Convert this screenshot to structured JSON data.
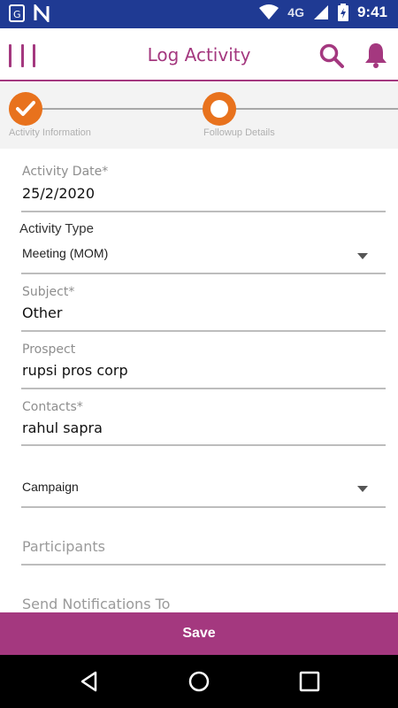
{
  "status_bar": {
    "network": "4G",
    "time": "9:41",
    "icons": [
      "sim-icon",
      "notification-n-icon",
      "wifi-icon",
      "signal-icon",
      "battery-charging-icon"
    ]
  },
  "app_bar": {
    "title": "Log Activity",
    "accent_color": "#a4387f"
  },
  "stepper": {
    "steps": [
      {
        "label": "Activity Information",
        "state": "completed"
      },
      {
        "label": "Followup Details",
        "state": "current"
      }
    ],
    "step_color": "#e8721d"
  },
  "form": {
    "activity_date": {
      "label": "Activity Date*",
      "value": "25/2/2020"
    },
    "activity_type": {
      "label": "Activity Type",
      "value": "Meeting (MOM)"
    },
    "subject": {
      "label": "Subject*",
      "value": "Other"
    },
    "prospect": {
      "label": "Prospect",
      "value": "rupsi pros corp"
    },
    "contacts": {
      "label": "Contacts*",
      "value": "rahul sapra"
    },
    "campaign": {
      "value": "Campaign"
    },
    "participants": {
      "placeholder": "Participants"
    },
    "send_notifications": {
      "placeholder": "Send Notifications To"
    }
  },
  "actions": {
    "save_label": "Save"
  }
}
